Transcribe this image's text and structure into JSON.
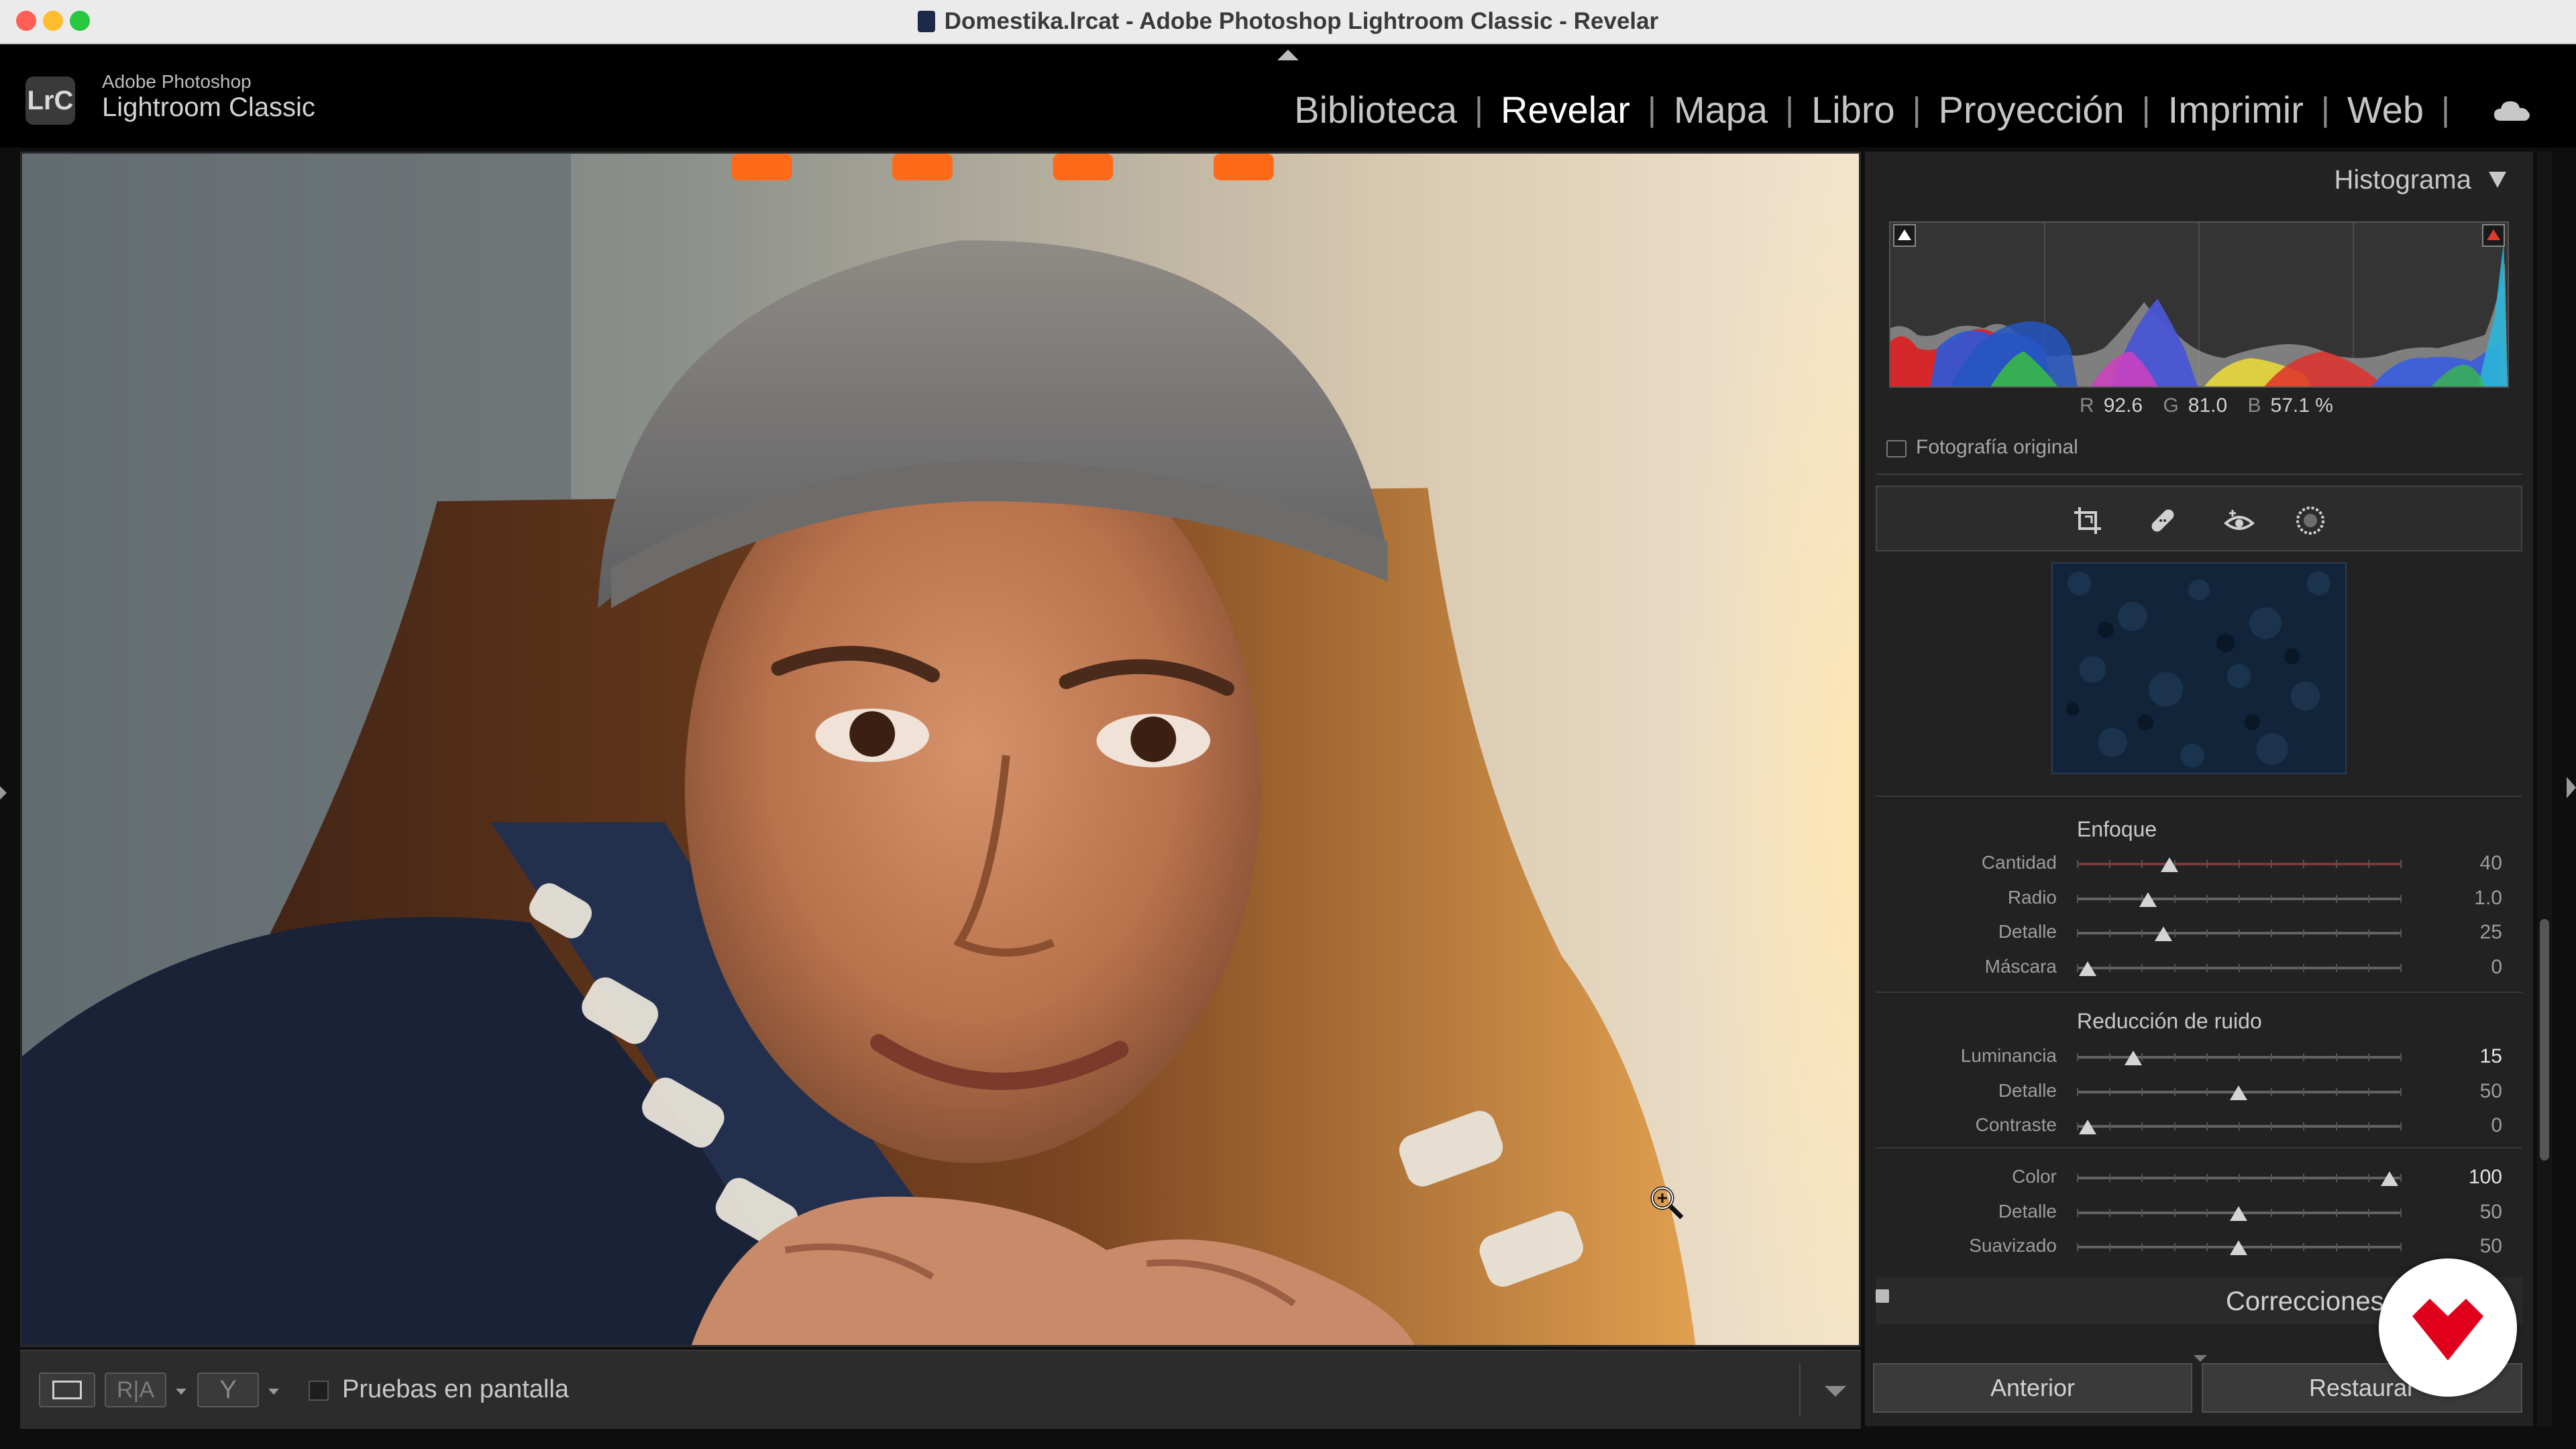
{
  "window": {
    "title": "Domestika.lrcat - Adobe Photoshop Lightroom Classic - Revelar"
  },
  "brand": {
    "logo": "LrC",
    "vendor": "Adobe Photoshop",
    "product": "Lightroom Classic"
  },
  "modules": [
    {
      "label": "Biblioteca",
      "active": false
    },
    {
      "label": "Revelar",
      "active": true
    },
    {
      "label": "Mapa",
      "active": false
    },
    {
      "label": "Libro",
      "active": false
    },
    {
      "label": "Proyección",
      "active": false
    },
    {
      "label": "Imprimir",
      "active": false
    },
    {
      "label": "Web",
      "active": false
    }
  ],
  "toolbar": {
    "before_after_label": "R|A",
    "y_label": "Y",
    "soft_proof_label": "Pruebas en pantalla"
  },
  "histogram": {
    "title": "Histograma",
    "r_label": "R",
    "r_value": "92.6",
    "g_label": "G",
    "g_value": "81.0",
    "b_label": "B",
    "b_value": "57.1 %",
    "original_label": "Fotografía original"
  },
  "tools": [
    "crop-icon",
    "healing-icon",
    "red-eye-icon",
    "mask-icon"
  ],
  "sharpening": {
    "title": "Enfoque",
    "sliders": [
      {
        "label": "Cantidad",
        "value": "40",
        "fraction": 0.27,
        "red_track": true
      },
      {
        "label": "Radio",
        "value": "1.0",
        "fraction": 0.2
      },
      {
        "label": "Detalle",
        "value": "25",
        "fraction": 0.25
      },
      {
        "label": "Máscara",
        "value": "0",
        "fraction": 0.0
      }
    ]
  },
  "noise_reduction": {
    "title": "Reducción de ruido",
    "luminance_sliders": [
      {
        "label": "Luminancia",
        "value": "15",
        "fraction": 0.15,
        "highlight": true
      },
      {
        "label": "Detalle",
        "value": "50",
        "fraction": 0.5
      },
      {
        "label": "Contraste",
        "value": "0",
        "fraction": 0.0
      }
    ],
    "color_sliders": [
      {
        "label": "Color",
        "value": "100",
        "fraction": 1.0,
        "highlight": true
      },
      {
        "label": "Detalle",
        "value": "50",
        "fraction": 0.5
      },
      {
        "label": "Suavizado",
        "value": "50",
        "fraction": 0.5
      }
    ]
  },
  "corrections": {
    "title": "Correcciones"
  },
  "buttons": {
    "previous": "Anterior",
    "reset": "Restaurar"
  },
  "colors": {
    "accent_red": "#e23a2a",
    "panel": "#222222",
    "watermark_red": "#e0001b"
  }
}
